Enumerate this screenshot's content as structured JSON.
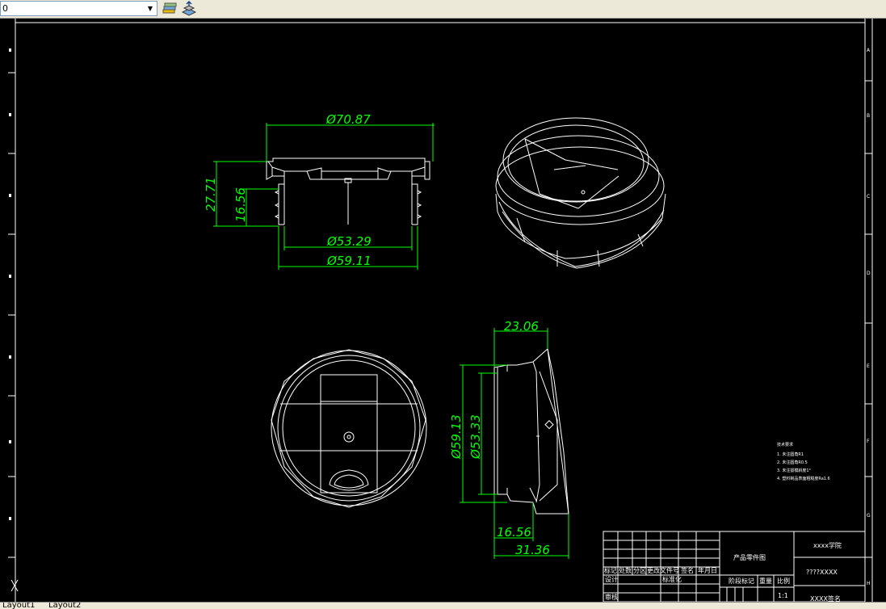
{
  "toolbar": {
    "layer_value": "0",
    "layer_combo_icon": "chevron-down-icon",
    "buttons": [
      {
        "name": "layer-previous-button",
        "icon": "layers-stack-icon"
      },
      {
        "name": "layer-states-button",
        "icon": "layers-arrow-icon"
      }
    ]
  },
  "colors": {
    "background": "#000000",
    "geometry": "#ffffff",
    "dimension": "#00ff00",
    "border": "#ffffff"
  },
  "dimensions": {
    "d1": "Ø70.87",
    "d2": "27.71",
    "d3": "16.56",
    "d4": "Ø53.29",
    "d5": "Ø59.11",
    "d6": "23.06",
    "d7": "Ø59.13",
    "d8": "Ø53.33",
    "d9": "16.56",
    "d10": "31.36"
  },
  "zone_labels": {
    "right": [
      "A",
      "B",
      "C",
      "D",
      "E",
      "F",
      "G",
      "H"
    ]
  },
  "notes": {
    "title": "技术要求",
    "items": [
      "1. 未注圆角R1",
      "2. 未注圆角R0.5",
      "3. 未注拔模斜度1°",
      "4. 塑料制品表面粗糙度Ra1.6"
    ]
  },
  "title_block": {
    "school": "xxxx学院",
    "part_title": "产品零件图",
    "drawing_no": "????XXXX",
    "name": "XXXX签名",
    "mark": "标记",
    "count": "处数",
    "zone": "分区",
    "change_doc": "更改文件号",
    "signature": "签名",
    "date": "年月日",
    "design": "设计",
    "standardize": "标准化",
    "review": "审核",
    "stage_mark": "阶段标记",
    "weight": "重量",
    "ratio": "比例",
    "ratio_value": "1:1"
  },
  "layout_tabs": [
    "Layout1",
    "Layout2"
  ]
}
